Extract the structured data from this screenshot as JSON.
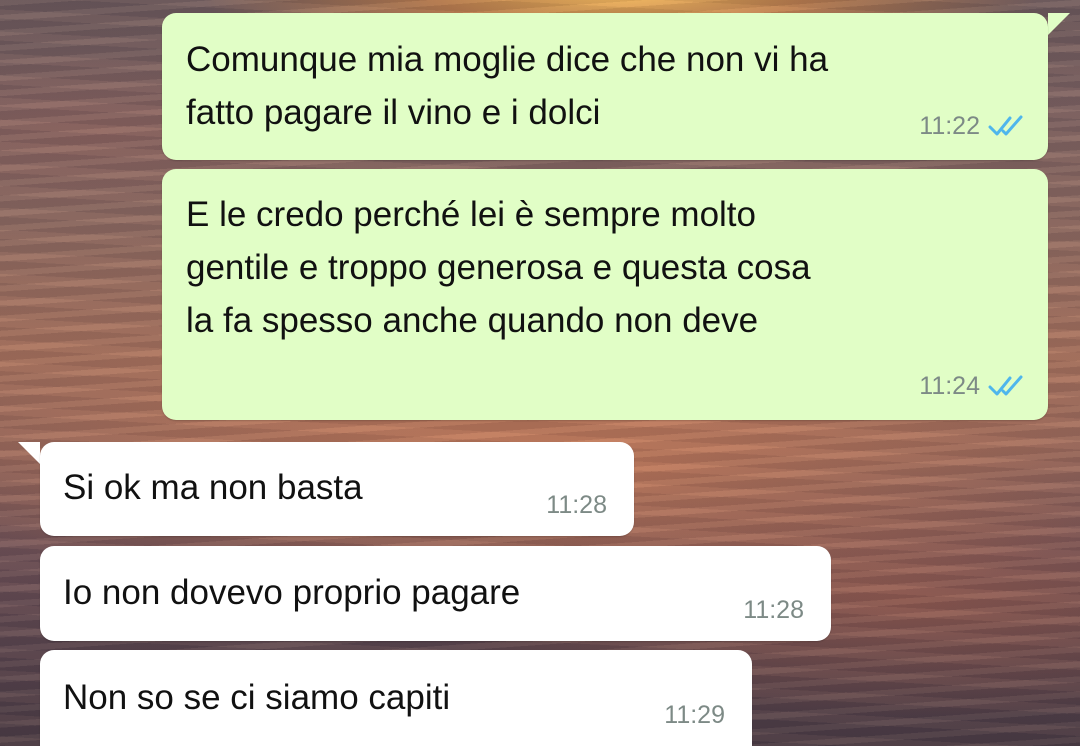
{
  "chat": {
    "messages": [
      {
        "direction": "outgoing",
        "text": "Comunque mia moglie dice che non vi ha\nfatto pagare il vino e i dolci",
        "time": "11:22",
        "status_icon": "double-check-read-icon"
      },
      {
        "direction": "outgoing",
        "text": "E le credo perché lei è sempre molto\ngentile e troppo generosa e questa cosa\nla fa spesso anche quando non deve",
        "time": "11:24",
        "status_icon": "double-check-read-icon"
      },
      {
        "direction": "incoming",
        "text": "Si ok ma non basta",
        "time": "11:28"
      },
      {
        "direction": "incoming",
        "text": "Io non dovevo proprio pagare",
        "time": "11:28"
      },
      {
        "direction": "incoming",
        "text": "Non so se ci siamo capiti",
        "time": "11:29"
      }
    ]
  },
  "colors": {
    "outgoing_bubble": "#e1fec6",
    "incoming_bubble": "#ffffff",
    "read_tick": "#4fb6ec",
    "timestamp": "#7d8a86"
  }
}
